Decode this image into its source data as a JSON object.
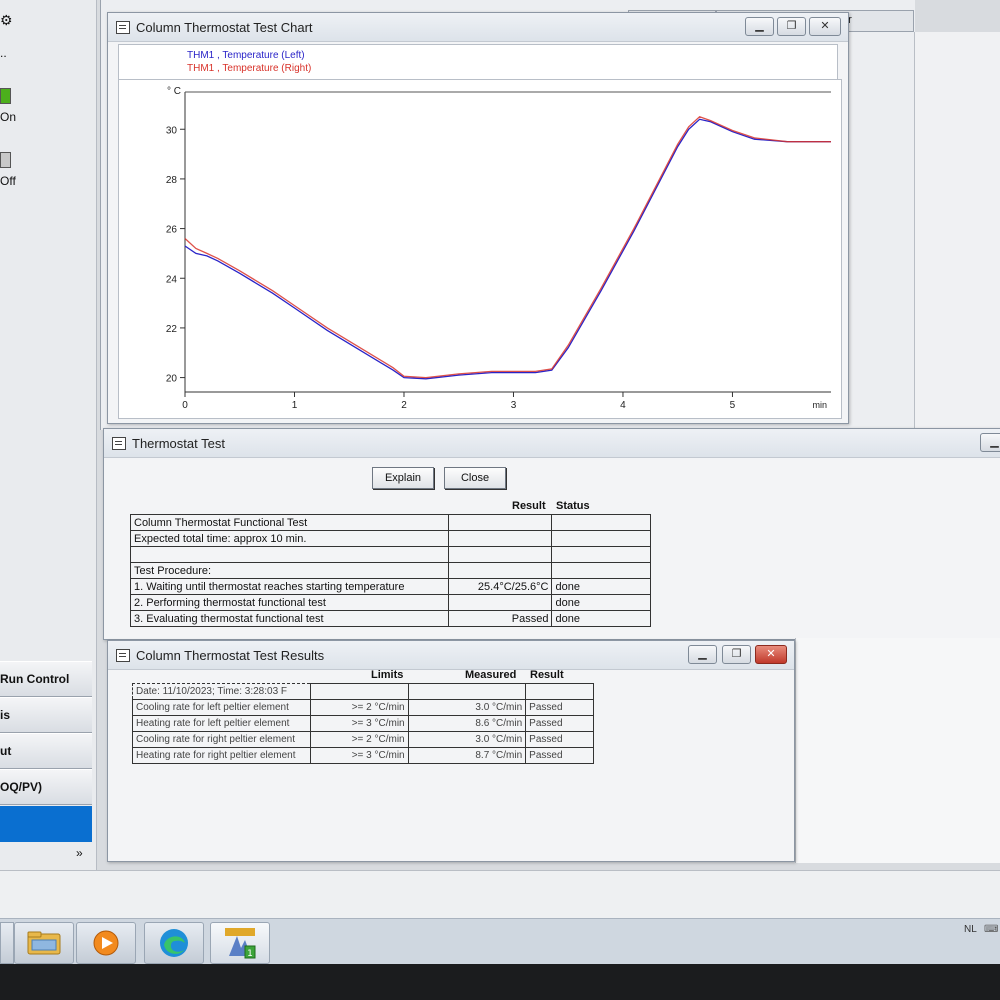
{
  "sidebar": {
    "toggle_on_label": "On",
    "toggle_off_label": "Off",
    "nav_items": [
      "Run Control",
      "is",
      "ut",
      "OQ/PV)"
    ],
    "more_glyph": "»",
    "colors": {
      "on": "#4caf1c",
      "off": "#c8c8c8",
      "active": "#0a6fd0"
    }
  },
  "background_tabs": [
    "r",
    "ter"
  ],
  "chart_window": {
    "title": "Column Thermostat Test Chart",
    "legend": [
      {
        "label": "THM1 , Temperature (Left)",
        "color": "#2a24c8"
      },
      {
        "label": "THM1 , Temperature (Right)",
        "color": "#d8322a"
      }
    ],
    "chart_data": {
      "type": "line",
      "ylabel": "° C",
      "xlabel": "min",
      "xlim": [
        0,
        5.9
      ],
      "ylim": [
        19.5,
        31.5
      ],
      "x_ticks": [
        0,
        1,
        2,
        3,
        4,
        5
      ],
      "y_ticks": [
        20,
        22,
        24,
        26,
        28,
        30
      ],
      "grid": false,
      "series": [
        {
          "name": "THM1 , Temperature (Left)",
          "color": "#2a24c8",
          "x": [
            0,
            0.1,
            0.2,
            0.3,
            0.5,
            0.8,
            1.0,
            1.3,
            1.6,
            1.9,
            2.0,
            2.2,
            2.5,
            2.8,
            3.0,
            3.2,
            3.35,
            3.5,
            3.8,
            4.1,
            4.3,
            4.5,
            4.6,
            4.7,
            4.8,
            5.0,
            5.2,
            5.5,
            5.9
          ],
          "y": [
            25.3,
            25.0,
            24.9,
            24.7,
            24.2,
            23.4,
            22.8,
            21.9,
            21.1,
            20.3,
            20.0,
            19.95,
            20.1,
            20.2,
            20.2,
            20.2,
            20.3,
            21.2,
            23.5,
            25.9,
            27.6,
            29.3,
            30.0,
            30.4,
            30.3,
            29.9,
            29.6,
            29.5,
            29.5
          ]
        },
        {
          "name": "THM1 , Temperature (Right)",
          "color": "#d8322a",
          "x": [
            0,
            0.1,
            0.2,
            0.3,
            0.5,
            0.8,
            1.0,
            1.3,
            1.6,
            1.9,
            2.0,
            2.2,
            2.5,
            2.8,
            3.0,
            3.2,
            3.35,
            3.5,
            3.8,
            4.1,
            4.3,
            4.5,
            4.6,
            4.7,
            4.8,
            5.0,
            5.2,
            5.5,
            5.9
          ],
          "y": [
            25.6,
            25.2,
            25.0,
            24.8,
            24.3,
            23.5,
            22.9,
            22.0,
            21.2,
            20.4,
            20.05,
            20.0,
            20.15,
            20.25,
            20.25,
            20.25,
            20.35,
            21.3,
            23.6,
            26.0,
            27.7,
            29.4,
            30.1,
            30.5,
            30.35,
            29.95,
            29.65,
            29.5,
            29.5
          ]
        }
      ]
    }
  },
  "test_window": {
    "title": "Thermostat Test",
    "explain_label": "Explain",
    "close_label": "Close",
    "header_result": "Result",
    "header_status": "Status",
    "rows": [
      {
        "label": "Column Thermostat Functional Test",
        "result": "",
        "status": ""
      },
      {
        "label": "Expected total time: approx 10 min.",
        "result": "",
        "status": ""
      },
      {
        "label": "",
        "result": "",
        "status": ""
      },
      {
        "label": "Test Procedure:",
        "result": "",
        "status": ""
      },
      {
        "label": "1. Waiting until thermostat reaches starting temperature",
        "result": "25.4°C/25.6°C",
        "status": "done"
      },
      {
        "label": "2. Performing thermostat functional test",
        "result": "",
        "status": "done"
      },
      {
        "label": "3. Evaluating thermostat functional test",
        "result": "Passed",
        "status": "done"
      }
    ]
  },
  "results_window": {
    "title": "Column Thermostat Test Results",
    "header_limits": "Limits",
    "header_measured": "Measured",
    "header_result": "Result",
    "date_line": "Date: 11/10/2023; Time: 3:28:03 F",
    "rows": [
      {
        "label": "Cooling rate for left peltier element",
        "limit": ">= 2 °C/min",
        "measured": "3.0 °C/min",
        "result": "Passed"
      },
      {
        "label": "Heating rate for left peltier element",
        "limit": ">= 3 °C/min",
        "measured": "8.6 °C/min",
        "result": "Passed"
      },
      {
        "label": "Cooling rate for right peltier element",
        "limit": ">= 2 °C/min",
        "measured": "3.0 °C/min",
        "result": "Passed"
      },
      {
        "label": "Heating rate for right peltier element",
        "limit": ">= 3 °C/min",
        "measured": "8.7 °C/min",
        "result": "Passed"
      }
    ]
  },
  "taskbar": {
    "apps": [
      "file-explorer-icon",
      "media-player-icon",
      "edge-browser-icon",
      "chemstation-icon"
    ],
    "language": "NL"
  }
}
